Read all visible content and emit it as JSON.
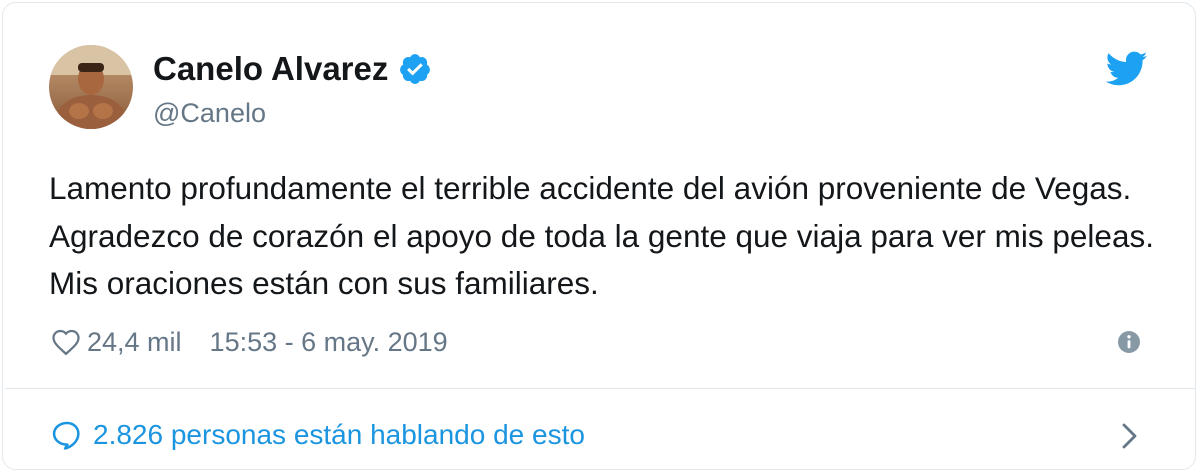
{
  "tweet": {
    "author": {
      "display_name": "Canelo Alvarez",
      "handle": "@Canelo",
      "verified": true
    },
    "text": "Lamento profundamente el terrible accidente del avión proveniente de Vegas. Agradezco de corazón el apoyo de toda la gente que viaja para ver mis peleas. Mis oraciones están con sus familiares.",
    "likes": "24,4 mil",
    "timestamp": "15:53 - 6 may. 2019",
    "conversation": "2.826 personas están hablando de esto"
  },
  "icons": {
    "verified": "verified-badge-icon",
    "brand": "twitter-bird-icon",
    "like": "heart-outline-icon",
    "info": "info-icon",
    "reply": "speech-bubble-icon",
    "more": "chevron-right-icon"
  },
  "colors": {
    "brand_blue": "#1da1f2",
    "link_blue": "#1b95e0",
    "text_primary": "#14171a",
    "text_secondary": "#657786",
    "border": "#e1e8ed"
  }
}
